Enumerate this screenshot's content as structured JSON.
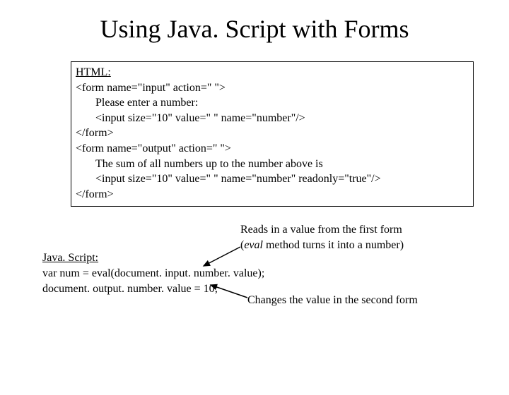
{
  "title": "Using Java. Script with Forms",
  "box": {
    "heading": "HTML:",
    "l1": "<form name=\"input\" action=\" \">",
    "l2": "Please enter a number:",
    "l3": "<input size=\"10\" value=\" \" name=\"number\"/>",
    "l4": "</form>",
    "l5": "<form name=\"output\" action=\" \">",
    "l6": "The sum of all numbers up to the number above is",
    "l7": "<input size=\"10\" value=\" \" name=\"number\" readonly=\"true\"/>",
    "l8": "</form>"
  },
  "js": {
    "heading": "Java. Script:",
    "l1": "var num = eval(document. input. number. value);",
    "l2": "document. output. number. value = 10;"
  },
  "note1": {
    "line1": "Reads in a value from the first form",
    "line2_pre": "(",
    "line2_em": "eval",
    "line2_post": " method turns it into a number)"
  },
  "note2": "Changes the value in the second form"
}
